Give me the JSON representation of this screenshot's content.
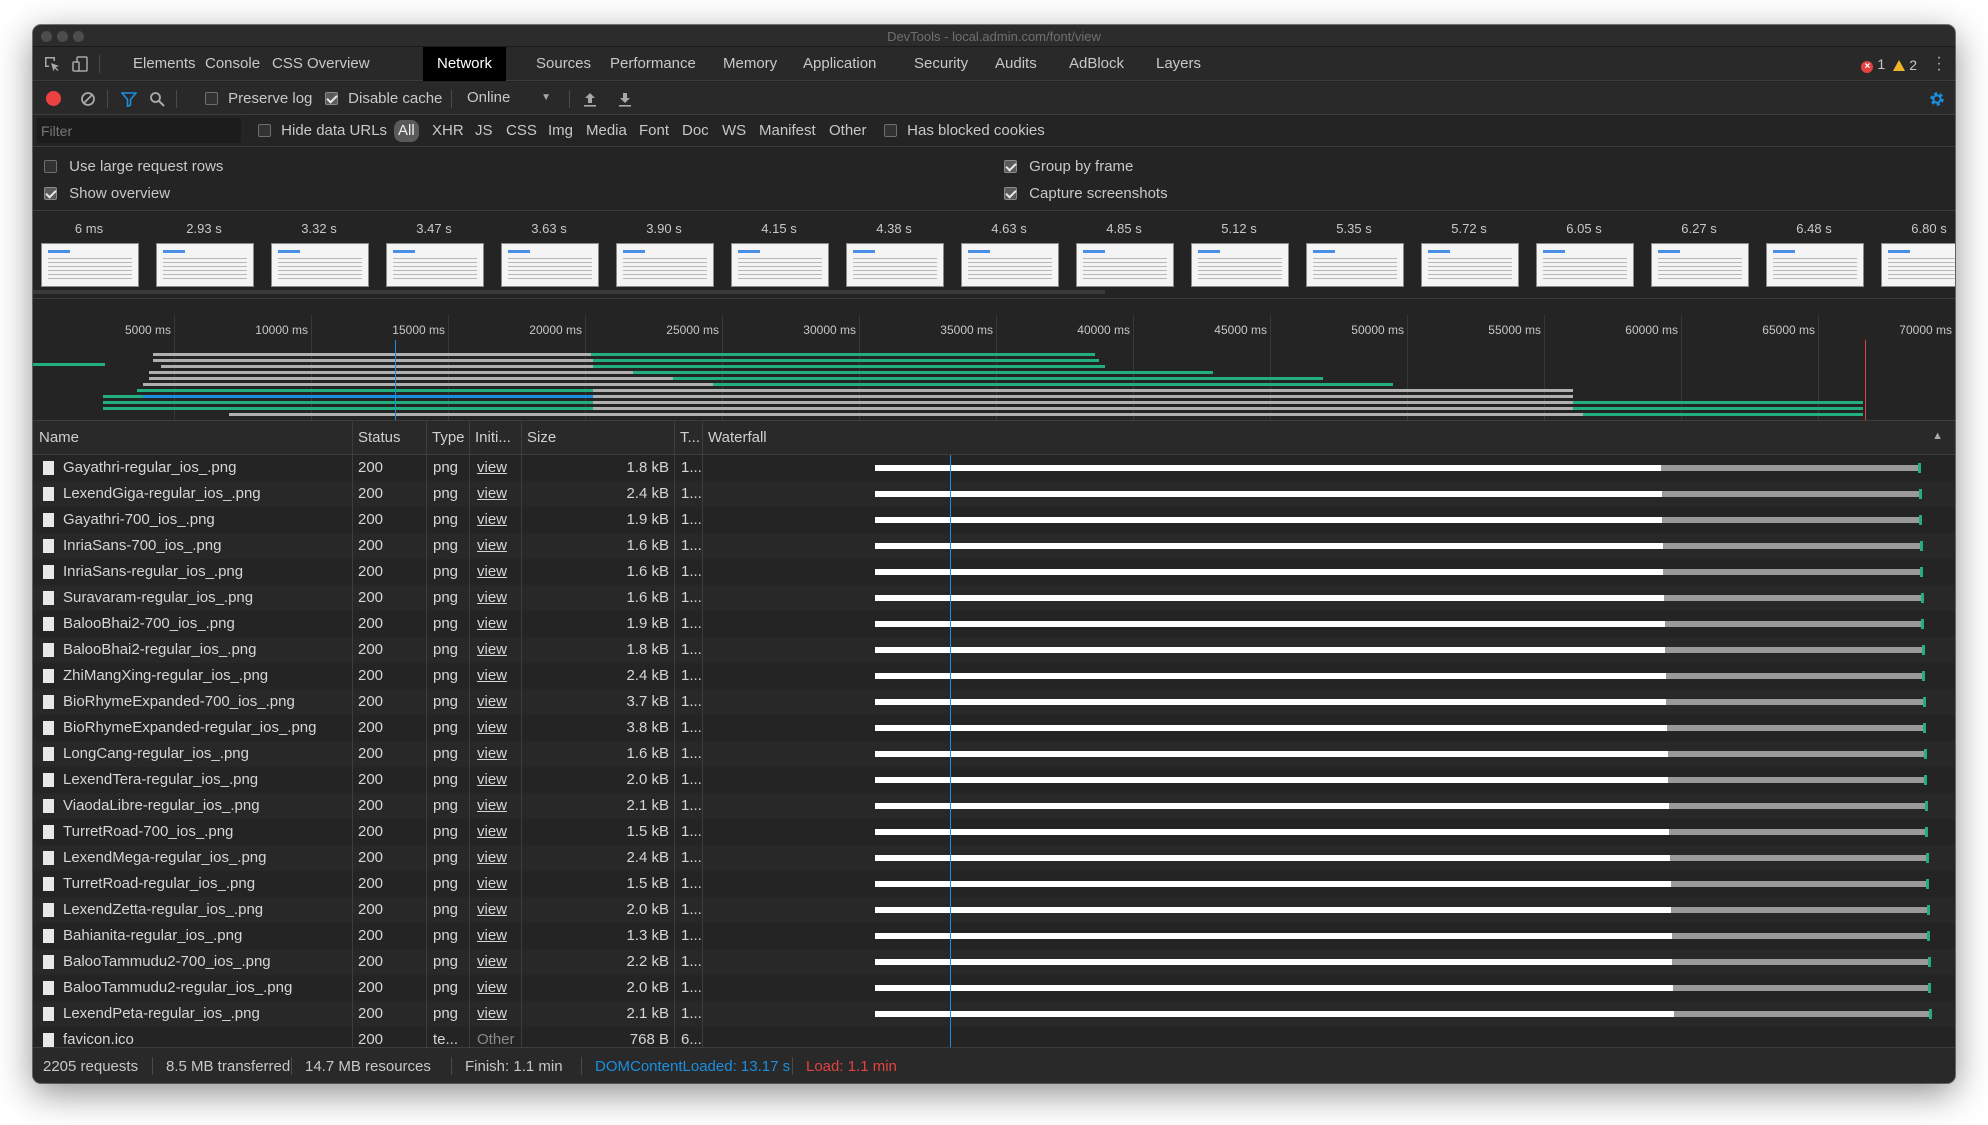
{
  "window": {
    "title": "DevTools - local.admin.com/font/view"
  },
  "tabs": [
    "Elements",
    "Console",
    "CSS Overview",
    "Network",
    "Sources",
    "Performance",
    "Memory",
    "Application",
    "Security",
    "Audits",
    "AdBlock",
    "Layers"
  ],
  "active_tab": "Network",
  "badges": {
    "errors": "1",
    "warnings": "2"
  },
  "toolbar": {
    "preserve_log_label": "Preserve log",
    "preserve_log_checked": false,
    "disable_cache_label": "Disable cache",
    "disable_cache_checked": true,
    "throttling_value": "Online"
  },
  "filterbar": {
    "placeholder": "Filter",
    "hide_data_urls_label": "Hide data URLs",
    "types": [
      "All",
      "XHR",
      "JS",
      "CSS",
      "Img",
      "Media",
      "Font",
      "Doc",
      "WS",
      "Manifest",
      "Other"
    ],
    "active_type": "All",
    "blocked_cookies_label": "Has blocked cookies"
  },
  "settings": {
    "large_rows": {
      "label": "Use large request rows",
      "checked": false
    },
    "show_overview": {
      "label": "Show overview",
      "checked": true
    },
    "group_by_frame": {
      "label": "Group by frame",
      "checked": true
    },
    "capture_screenshots": {
      "label": "Capture screenshots",
      "checked": true
    }
  },
  "filmstrip": [
    "6 ms",
    "2.93 s",
    "3.32 s",
    "3.47 s",
    "3.63 s",
    "3.90 s",
    "4.15 s",
    "4.38 s",
    "4.63 s",
    "4.85 s",
    "5.12 s",
    "5.35 s",
    "5.72 s",
    "6.05 s",
    "6.27 s",
    "6.48 s",
    "6.80 s"
  ],
  "overview_ticks": [
    "5000 ms",
    "10000 ms",
    "15000 ms",
    "20000 ms",
    "25000 ms",
    "30000 ms",
    "35000 ms",
    "40000 ms",
    "45000 ms",
    "50000 ms",
    "55000 ms",
    "60000 ms",
    "65000 ms",
    "70000 ms"
  ],
  "columns": {
    "name": "Name",
    "status": "Status",
    "type": "Type",
    "initiator": "Initi...",
    "size": "Size",
    "time": "T...",
    "waterfall": "Waterfall"
  },
  "rows": [
    {
      "name": "Gayathri-regular_ios_.png",
      "status": "200",
      "type": "png",
      "initiator": "view",
      "size": "1.8 kB",
      "time": "1..."
    },
    {
      "name": "LexendGiga-regular_ios_.png",
      "status": "200",
      "type": "png",
      "initiator": "view",
      "size": "2.4 kB",
      "time": "1..."
    },
    {
      "name": "Gayathri-700_ios_.png",
      "status": "200",
      "type": "png",
      "initiator": "view",
      "size": "1.9 kB",
      "time": "1..."
    },
    {
      "name": "InriaSans-700_ios_.png",
      "status": "200",
      "type": "png",
      "initiator": "view",
      "size": "1.6 kB",
      "time": "1..."
    },
    {
      "name": "InriaSans-regular_ios_.png",
      "status": "200",
      "type": "png",
      "initiator": "view",
      "size": "1.6 kB",
      "time": "1..."
    },
    {
      "name": "Suravaram-regular_ios_.png",
      "status": "200",
      "type": "png",
      "initiator": "view",
      "size": "1.6 kB",
      "time": "1..."
    },
    {
      "name": "BalooBhai2-700_ios_.png",
      "status": "200",
      "type": "png",
      "initiator": "view",
      "size": "1.9 kB",
      "time": "1..."
    },
    {
      "name": "BalooBhai2-regular_ios_.png",
      "status": "200",
      "type": "png",
      "initiator": "view",
      "size": "1.8 kB",
      "time": "1..."
    },
    {
      "name": "ZhiMangXing-regular_ios_.png",
      "status": "200",
      "type": "png",
      "initiator": "view",
      "size": "2.4 kB",
      "time": "1..."
    },
    {
      "name": "BioRhymeExpanded-700_ios_.png",
      "status": "200",
      "type": "png",
      "initiator": "view",
      "size": "3.7 kB",
      "time": "1..."
    },
    {
      "name": "BioRhymeExpanded-regular_ios_.png",
      "status": "200",
      "type": "png",
      "initiator": "view",
      "size": "3.8 kB",
      "time": "1..."
    },
    {
      "name": "LongCang-regular_ios_.png",
      "status": "200",
      "type": "png",
      "initiator": "view",
      "size": "1.6 kB",
      "time": "1..."
    },
    {
      "name": "LexendTera-regular_ios_.png",
      "status": "200",
      "type": "png",
      "initiator": "view",
      "size": "2.0 kB",
      "time": "1..."
    },
    {
      "name": "ViaodaLibre-regular_ios_.png",
      "status": "200",
      "type": "png",
      "initiator": "view",
      "size": "2.1 kB",
      "time": "1..."
    },
    {
      "name": "TurretRoad-700_ios_.png",
      "status": "200",
      "type": "png",
      "initiator": "view",
      "size": "1.5 kB",
      "time": "1..."
    },
    {
      "name": "LexendMega-regular_ios_.png",
      "status": "200",
      "type": "png",
      "initiator": "view",
      "size": "2.4 kB",
      "time": "1..."
    },
    {
      "name": "TurretRoad-regular_ios_.png",
      "status": "200",
      "type": "png",
      "initiator": "view",
      "size": "1.5 kB",
      "time": "1..."
    },
    {
      "name": "LexendZetta-regular_ios_.png",
      "status": "200",
      "type": "png",
      "initiator": "view",
      "size": "2.0 kB",
      "time": "1..."
    },
    {
      "name": "Bahianita-regular_ios_.png",
      "status": "200",
      "type": "png",
      "initiator": "view",
      "size": "1.3 kB",
      "time": "1..."
    },
    {
      "name": "BalooTammudu2-700_ios_.png",
      "status": "200",
      "type": "png",
      "initiator": "view",
      "size": "2.2 kB",
      "time": "1..."
    },
    {
      "name": "BalooTammudu2-regular_ios_.png",
      "status": "200",
      "type": "png",
      "initiator": "view",
      "size": "2.0 kB",
      "time": "1..."
    },
    {
      "name": "LexendPeta-regular_ios_.png",
      "status": "200",
      "type": "png",
      "initiator": "view",
      "size": "2.1 kB",
      "time": "1..."
    },
    {
      "name": "favicon.ico",
      "status": "200",
      "type": "te...",
      "initiator": "Other",
      "size": "768 B",
      "time": "6..."
    }
  ],
  "status": {
    "requests": "2205 requests",
    "transferred": "8.5 MB transferred",
    "resources": "14.7 MB resources",
    "finish": "Finish: 1.1 min",
    "dom_content_loaded": "DOMContentLoaded: 13.17 s",
    "load": "Load: 1.1 min"
  },
  "colors": {
    "accent_blue": "#1a8fe0",
    "record_red": "#ec4141",
    "load_red": "#e34242",
    "receiving_green": "#21b07d",
    "active_tab_bg": "#000000"
  }
}
